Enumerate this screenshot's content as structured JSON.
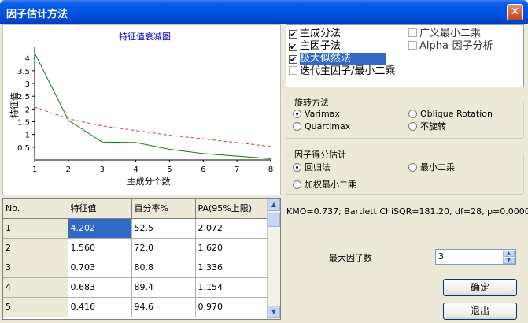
{
  "window": {
    "title": "因子估计方法",
    "close_glyph": "✕"
  },
  "chart_data": {
    "type": "line",
    "title": "特征值衰减图",
    "xlabel": "主成分个数",
    "ylabel": "特征值",
    "x": [
      1,
      2,
      3,
      4,
      5,
      6,
      7,
      8
    ],
    "xlim": [
      1,
      8
    ],
    "ylim": [
      0,
      4.3
    ],
    "xticks": [
      "1",
      "2",
      "3",
      "4",
      "5",
      "6",
      "7",
      "8"
    ],
    "yticks": [
      "0.5",
      "1",
      "1.5",
      "2",
      "2.5",
      "3",
      "3.5",
      "4"
    ],
    "series": [
      {
        "values": [
          4.202,
          1.56,
          0.703,
          0.683,
          0.416,
          0.25,
          0.15,
          0.05
        ],
        "color": "#008000",
        "style": "solid"
      },
      {
        "values": [
          2.072,
          1.62,
          1.336,
          1.154,
          0.97,
          0.83,
          0.68,
          0.53
        ],
        "color": "#e03030",
        "style": "dashed"
      }
    ]
  },
  "grid": {
    "headers": [
      "No.",
      "特征值",
      "百分率%",
      "PA(95%上限)"
    ],
    "rows": [
      [
        "1",
        "4.202",
        "52.5",
        "2.072"
      ],
      [
        "2",
        "1.560",
        "72.0",
        "1.620"
      ],
      [
        "3",
        "0.703",
        "80.8",
        "1.336"
      ],
      [
        "4",
        "0.683",
        "89.4",
        "1.154"
      ],
      [
        "5",
        "0.416",
        "94.6",
        "0.970"
      ]
    ],
    "scroll_up": "▲",
    "scroll_down": "▼"
  },
  "methods": {
    "items": [
      {
        "label": "主成分法",
        "checked": true,
        "check": "✔"
      },
      {
        "label": "主因子法",
        "checked": true,
        "check": "✔"
      },
      {
        "label": "极大似然法",
        "checked": true,
        "check": "✔"
      },
      {
        "label": "迭代主因子/最小二乘",
        "checked": false,
        "check": ""
      },
      {
        "label": "广义最小二乘",
        "checked": false,
        "check": ""
      },
      {
        "label": "Alpha-因子分析",
        "checked": false,
        "check": ""
      }
    ]
  },
  "rotation": {
    "title": "旋转方法",
    "options": [
      "Varimax",
      "Oblique Rotation",
      "Quartimax",
      "不旋转"
    ],
    "selected": "Varimax"
  },
  "score": {
    "title": "因子得分估计",
    "options": [
      "回归法",
      "最小二乘",
      "加权最小二乘"
    ],
    "selected": "回归法"
  },
  "stats": {
    "text": "KMO=0.737;  Bartlett ChiSQR=181.20, df=28, p=0.0000"
  },
  "max_factors": {
    "label": "最大因子数",
    "value": "3",
    "up": "▲",
    "down": "▼"
  },
  "buttons": {
    "ok": "确定",
    "exit": "退出"
  }
}
